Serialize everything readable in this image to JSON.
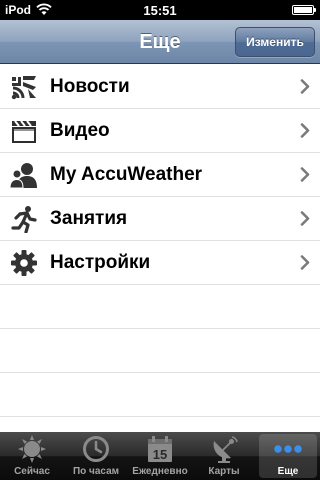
{
  "status_bar": {
    "carrier": "iPod",
    "time": "15:51",
    "battery_level": 1.0
  },
  "nav": {
    "title": "Еще",
    "edit_label": "Изменить"
  },
  "menu": {
    "items": [
      {
        "label": "Новости",
        "icon": "news-icon"
      },
      {
        "label": "Видео",
        "icon": "video-icon"
      },
      {
        "label": "My AccuWeather",
        "icon": "users-icon"
      },
      {
        "label": "Занятия",
        "icon": "running-icon"
      },
      {
        "label": "Настройки",
        "icon": "gear-icon"
      }
    ]
  },
  "tabs": [
    {
      "label": "Сейчас",
      "icon": "sun-icon",
      "active": false
    },
    {
      "label": "По часам",
      "icon": "clock-icon",
      "active": false
    },
    {
      "label": "Ежедневно",
      "icon": "calendar-icon",
      "active": false,
      "icon_text": "15"
    },
    {
      "label": "Карты",
      "icon": "satellite-icon",
      "active": false
    },
    {
      "label": "Еще",
      "icon": "more-icon",
      "active": true
    }
  ],
  "colors": {
    "nav_accent": "#6d86a7",
    "tab_active_dots": "#3b8fe8"
  }
}
